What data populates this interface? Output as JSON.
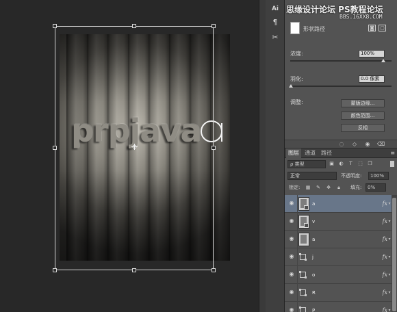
{
  "canvas": {
    "artwork_text": "prpjava",
    "outline_letter": "a"
  },
  "toolbar": {
    "tools": [
      {
        "icon": "paragraph-icon",
        "glyph": "¶"
      },
      {
        "icon": "scissors-icon",
        "glyph": "✂"
      }
    ],
    "top_label": "Ai"
  },
  "watermark": {
    "line1": "思缘设计论坛  PS教程论坛",
    "line2": "BBS.16XX8.COM"
  },
  "properties": {
    "title": "形状路径",
    "density_label": "浓度:",
    "density_value": "100%",
    "feather_label": "羽化:",
    "feather_value": "0.0 像素",
    "adjust_label": "调整:",
    "buttons": [
      "蒙版边缘...",
      "颜色范围...",
      "反相"
    ]
  },
  "layers_panel": {
    "tabs": [
      "图层",
      "通道",
      "路径"
    ],
    "active_tab": 0,
    "filter_label": "ρ 类型",
    "blend_mode": "正常",
    "opacity_label": "不透明度:",
    "opacity_value": "100%",
    "lock_label": "锁定:",
    "fill_label": "填充:",
    "fill_value": "0%",
    "layers": [
      {
        "name": "a",
        "kind": "thumb",
        "fx": "fx",
        "selected": true
      },
      {
        "name": "v",
        "kind": "thumb",
        "fx": "fx",
        "selected": false
      },
      {
        "name": "a",
        "kind": "thumb",
        "fx": "fx",
        "selected": false
      },
      {
        "name": "j",
        "kind": "shape",
        "fx": "fx",
        "selected": false
      },
      {
        "name": "o",
        "kind": "shape",
        "fx": "fx",
        "selected": false
      },
      {
        "name": "R",
        "kind": "shape",
        "fx": "fx",
        "selected": false
      },
      {
        "name": "P",
        "kind": "shape",
        "fx": "fx",
        "selected": false
      }
    ]
  },
  "colors": {
    "selection": "#687689",
    "panel": "#535353",
    "canvas_bg": "#282828"
  }
}
